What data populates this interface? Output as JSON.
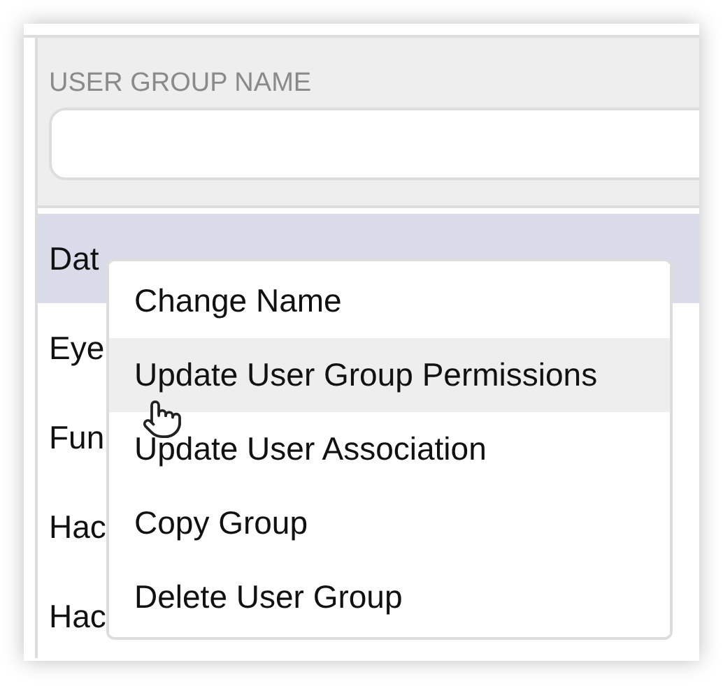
{
  "filter": {
    "label": "USER GROUP NAME"
  },
  "groups": [
    {
      "name": "Dat",
      "selected": true
    },
    {
      "name": "Eye",
      "selected": false
    },
    {
      "name": "Fun",
      "selected": false
    },
    {
      "name": "Hac",
      "selected": false
    },
    {
      "name": "Hac",
      "selected": false
    }
  ],
  "context_menu": {
    "items": [
      {
        "label": "Change Name",
        "selected": false
      },
      {
        "label": "Update User Group Permissions",
        "selected": true
      },
      {
        "label": "Update User Association",
        "selected": false
      },
      {
        "label": "Copy Group",
        "selected": false
      },
      {
        "label": "Delete User Group",
        "selected": false
      }
    ]
  }
}
